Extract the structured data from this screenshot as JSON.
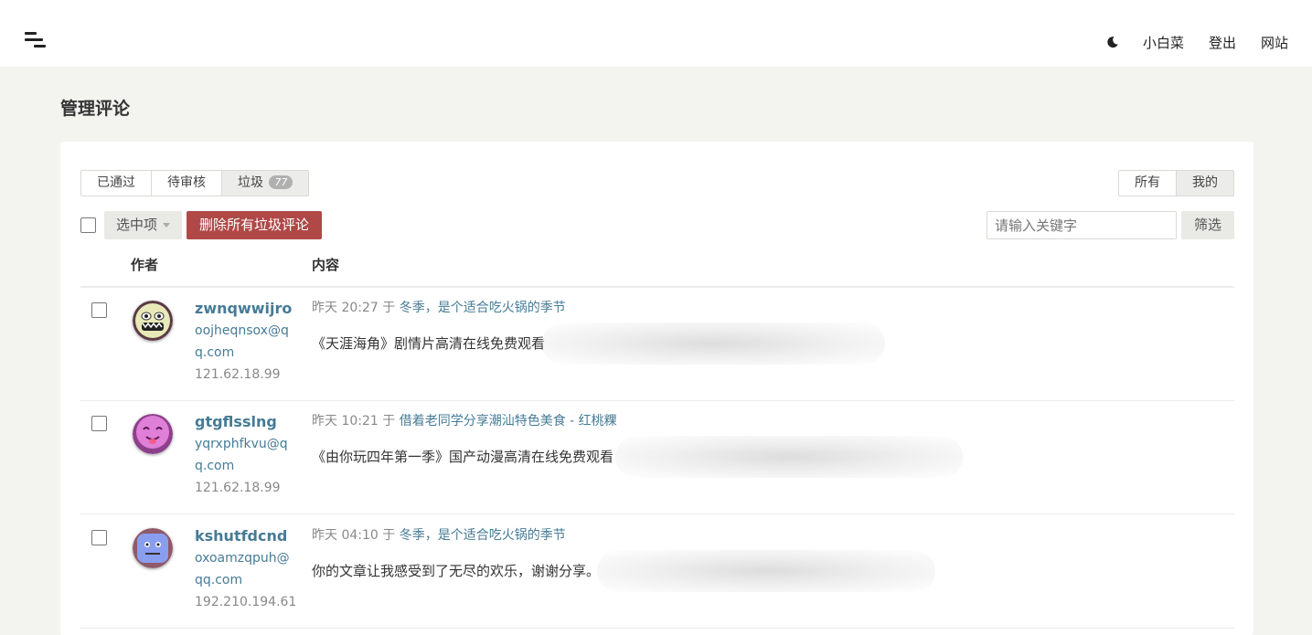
{
  "header": {
    "user_label": "小白菜",
    "logout_label": "登出",
    "site_label": "网站"
  },
  "page": {
    "title": "管理评论"
  },
  "tabs": {
    "approved": "已通过",
    "pending": "待审核",
    "spam": "垃圾",
    "spam_count": "77"
  },
  "scope": {
    "all": "所有",
    "mine": "我的"
  },
  "actions": {
    "selected_label": "选中项",
    "delete_spam_label": "删除所有垃圾评论"
  },
  "search": {
    "placeholder": "请输入关键字",
    "filter_label": "筛选"
  },
  "table": {
    "author_header": "作者",
    "content_header": "内容"
  },
  "comments": [
    {
      "author": "zwnqwwijro",
      "email": "oojheqnsox@qq.com",
      "ip": "121.62.18.99",
      "time": "昨天 20:27",
      "in": "于",
      "post": "冬季，是个适合吃火锅的季节",
      "text": "《天涯海角》剧情片高清在线免费观看"
    },
    {
      "author": "gtgflsslng",
      "email": "yqrxphfkvu@qq.com",
      "ip": "121.62.18.99",
      "time": "昨天 10:21",
      "in": "于",
      "post": "借着老同学分享潮汕特色美食 - 红桃粿",
      "text": "《由你玩四年第一季》国产动漫高清在线免费观看"
    },
    {
      "author": "kshutfdcnd",
      "email": "oxoamzqpuh@qq.com",
      "ip": "192.210.194.61",
      "time": "昨天 04:10",
      "in": "于",
      "post": "冬季，是个适合吃火锅的季节",
      "text": "你的文章让我感受到了无尽的欢乐，谢谢分享。"
    }
  ]
}
